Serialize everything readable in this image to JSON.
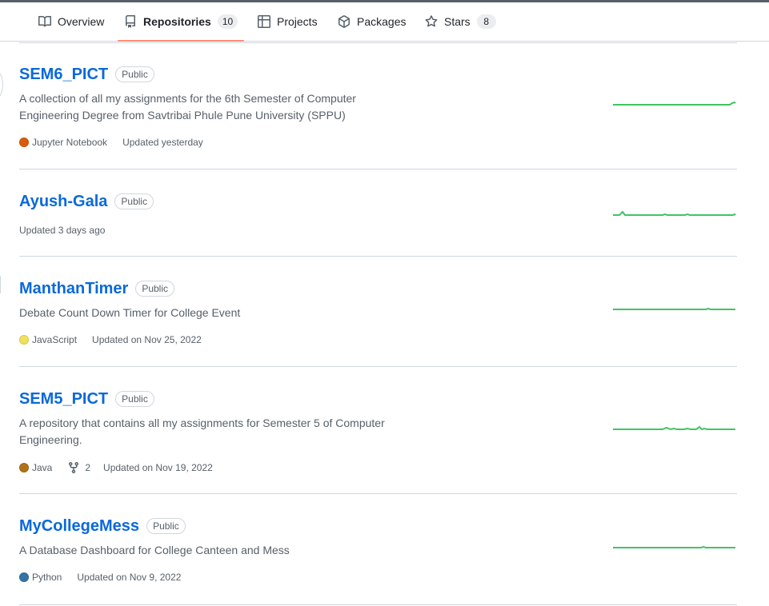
{
  "tabs": [
    {
      "label": "Overview",
      "icon": "book-icon"
    },
    {
      "label": "Repositories",
      "icon": "repo-icon",
      "count": "10",
      "active": true
    },
    {
      "label": "Projects",
      "icon": "table-icon"
    },
    {
      "label": "Packages",
      "icon": "package-icon"
    },
    {
      "label": "Stars",
      "icon": "star-icon",
      "count": "8"
    }
  ],
  "colors": {
    "link": "#0969da",
    "underline": "#fd8c73",
    "sparkline": "#40c463",
    "jupyter": "#DA5B0B",
    "javascript": "#f1e05a",
    "java": "#b07219",
    "python": "#3572A5"
  },
  "repos": [
    {
      "name": "SEM6_PICT",
      "visibility": "Public",
      "description": "A collection of all my assignments for the 6th Semester of Computer Engineering Degree from Savtribai Phule Pune University (SPPU)",
      "language": "Jupyter Notebook",
      "language_color": "#DA5B0B",
      "updated": "Updated yesterday"
    },
    {
      "name": "Ayush-Gala",
      "visibility": "Public",
      "updated": "Updated 3 days ago"
    },
    {
      "name": "ManthanTimer",
      "visibility": "Public",
      "description": "Debate Count Down Timer for College Event",
      "language": "JavaScript",
      "language_color": "#f1e05a",
      "updated": "Updated on Nov 25, 2022"
    },
    {
      "name": "SEM5_PICT",
      "visibility": "Public",
      "description": "A repository that contains all my assignments for Semester 5 of Computer Engineering.",
      "language": "Java",
      "language_color": "#b07219",
      "forks": "2",
      "updated": "Updated on Nov 19, 2022"
    },
    {
      "name": "MyCollegeMess",
      "visibility": "Public",
      "description": "A Database Dashboard for College Canteen and Mess",
      "language": "Python",
      "language_color": "#3572A5",
      "updated": "Updated on Nov 9, 2022"
    }
  ]
}
